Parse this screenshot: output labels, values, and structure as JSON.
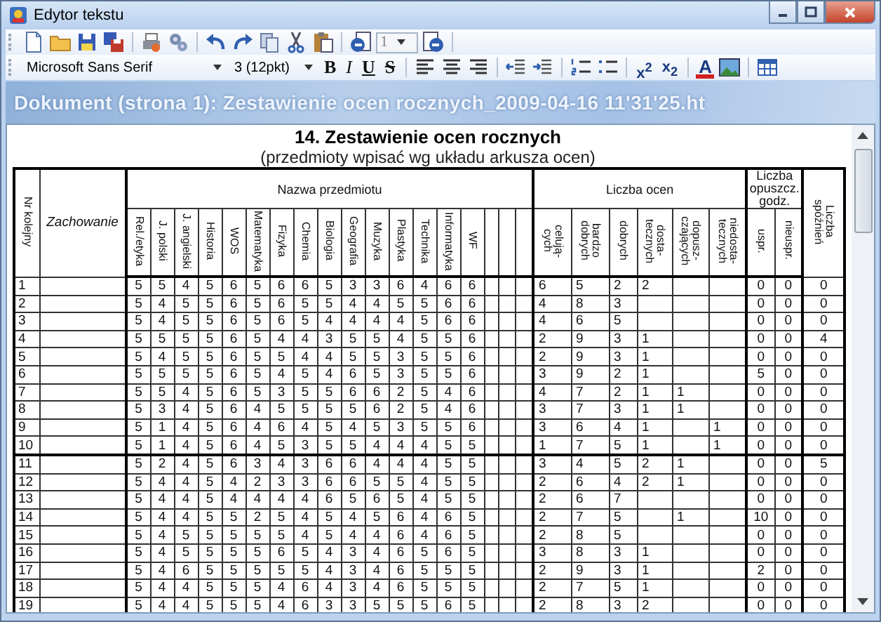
{
  "window": {
    "title": "Edytor tekstu"
  },
  "toolbar": {
    "page_spinner": {
      "value": "1"
    }
  },
  "format_bar": {
    "font": "Microsoft Sans Serif",
    "size": "3 (12pkt)",
    "style_buttons": [
      {
        "kind": "bold",
        "label": "B"
      },
      {
        "kind": "italic",
        "label": "I"
      },
      {
        "kind": "underline",
        "label": "U"
      },
      {
        "kind": "strike",
        "label": "S"
      }
    ],
    "script_buttons": [
      {
        "label": "x$^{2}$"
      },
      {
        "label": "x$_{2}$"
      }
    ],
    "font_color_button": {
      "label": "A"
    }
  },
  "banner": {
    "title": "Dokument (strona 1):  Zestawienie ocen rocznych_2009-04-16 11'31'25.ht"
  },
  "document": {
    "title": "14. Zestawienie ocen rocznych",
    "subtitle": "(przedmioty wpisać wg układu arkusza ocen)",
    "table": {
      "number_header": "Nr kolejny",
      "behaviour_header": "Zachowanie",
      "subjects_header": "Nazwa przedmiotu",
      "subjects": [
        "Rel./etyka",
        "J. polski",
        "J. angielski",
        "Historia",
        "WOS",
        "Matematyka",
        "Fizyka",
        "Chemia",
        "Biologia",
        "Geografia",
        "Muzyka",
        "Plastyka",
        "Technika",
        "Informatyka",
        "WF"
      ],
      "grades_header": "Liczba ocen",
      "grade_columns": [
        "celują-\ncych",
        "bardzo\ndobrych",
        "dobrych",
        "dosta-\ntecznych",
        "dopusz-\nczających",
        "niedosta-\ntecznych"
      ],
      "absences_header": "Liczba\nopuszcz.\ngodz.",
      "absence_columns": [
        "uspr.",
        "nieuspr."
      ],
      "late_header": "Liczba\nspóźnień",
      "rows": [
        {
          "nr": "1",
          "subject_grades": [
            "5",
            "5",
            "4",
            "5",
            "6",
            "5",
            "6",
            "6",
            "5",
            "3",
            "3",
            "6",
            "4",
            "6",
            "6"
          ],
          "grade_counts": {
            "excellent": "6",
            "very_good": "5",
            "good": "2",
            "satisfactory": "2"
          },
          "excused": "0",
          "unexcused": "0",
          "late": "0"
        },
        {
          "nr": "2",
          "subject_grades": [
            "5",
            "4",
            "5",
            "5",
            "6",
            "5",
            "6",
            "5",
            "5",
            "4",
            "4",
            "5",
            "5",
            "6",
            "6"
          ],
          "grade_counts": {
            "excellent": "4",
            "very_good": "8",
            "good": "3"
          },
          "excused": "0",
          "unexcused": "0",
          "late": "0"
        },
        {
          "nr": "3",
          "subject_grades": [
            "5",
            "4",
            "5",
            "5",
            "6",
            "5",
            "6",
            "5",
            "4",
            "4",
            "4",
            "4",
            "5",
            "6",
            "6"
          ],
          "grade_counts": {
            "excellent": "4",
            "very_good": "6",
            "good": "5"
          },
          "excused": "0",
          "unexcused": "0",
          "late": "0"
        },
        {
          "nr": "4",
          "subject_grades": [
            "5",
            "5",
            "5",
            "5",
            "6",
            "5",
            "4",
            "4",
            "3",
            "5",
            "5",
            "4",
            "5",
            "5",
            "6"
          ],
          "grade_counts": {
            "excellent": "2",
            "very_good": "9",
            "good": "3",
            "satisfactory": "1"
          },
          "excused": "0",
          "unexcused": "0",
          "late": "4"
        },
        {
          "nr": "5",
          "subject_grades": [
            "5",
            "4",
            "5",
            "5",
            "6",
            "5",
            "5",
            "4",
            "4",
            "5",
            "5",
            "3",
            "5",
            "5",
            "6"
          ],
          "grade_counts": {
            "excellent": "2",
            "very_good": "9",
            "good": "3",
            "satisfactory": "1"
          },
          "excused": "0",
          "unexcused": "0",
          "late": "0"
        },
        {
          "nr": "6",
          "subject_grades": [
            "5",
            "5",
            "5",
            "5",
            "6",
            "5",
            "4",
            "5",
            "4",
            "6",
            "5",
            "3",
            "5",
            "5",
            "6"
          ],
          "grade_counts": {
            "excellent": "3",
            "very_good": "9",
            "good": "2",
            "satisfactory": "1"
          },
          "excused": "5",
          "unexcused": "0",
          "late": "0"
        },
        {
          "nr": "7",
          "subject_grades": [
            "5",
            "5",
            "4",
            "5",
            "6",
            "5",
            "3",
            "5",
            "5",
            "6",
            "6",
            "2",
            "5",
            "4",
            "6"
          ],
          "grade_counts": {
            "excellent": "4",
            "very_good": "7",
            "good": "2",
            "satisfactory": "1",
            "sufficient": "1"
          },
          "excused": "0",
          "unexcused": "0",
          "late": "0"
        },
        {
          "nr": "8",
          "subject_grades": [
            "5",
            "3",
            "4",
            "5",
            "6",
            "4",
            "5",
            "5",
            "5",
            "5",
            "6",
            "2",
            "5",
            "4",
            "6"
          ],
          "grade_counts": {
            "excellent": "3",
            "very_good": "7",
            "good": "3",
            "satisfactory": "1",
            "sufficient": "1"
          },
          "excused": "0",
          "unexcused": "0",
          "late": "0"
        },
        {
          "nr": "9",
          "subject_grades": [
            "5",
            "1",
            "4",
            "5",
            "6",
            "4",
            "6",
            "4",
            "5",
            "4",
            "5",
            "3",
            "5",
            "5",
            "6"
          ],
          "grade_counts": {
            "excellent": "3",
            "very_good": "6",
            "good": "4",
            "satisfactory": "1",
            "insufficient": "1"
          },
          "excused": "0",
          "unexcused": "0",
          "late": "0"
        },
        {
          "nr": "10",
          "subject_grades": [
            "5",
            "1",
            "4",
            "5",
            "6",
            "4",
            "5",
            "3",
            "5",
            "5",
            "4",
            "4",
            "4",
            "5",
            "5"
          ],
          "grade_counts": {
            "excellent": "1",
            "very_good": "7",
            "good": "5",
            "satisfactory": "1",
            "insufficient": "1"
          },
          "excused": "0",
          "unexcused": "0",
          "late": "0"
        },
        {
          "nr": "11",
          "subject_grades": [
            "5",
            "2",
            "4",
            "5",
            "6",
            "3",
            "4",
            "3",
            "6",
            "6",
            "4",
            "4",
            "4",
            "5",
            "5"
          ],
          "grade_counts": {
            "excellent": "3",
            "very_good": "4",
            "good": "5",
            "satisfactory": "2",
            "sufficient": "1"
          },
          "excused": "0",
          "unexcused": "0",
          "late": "5"
        },
        {
          "nr": "12",
          "subject_grades": [
            "5",
            "4",
            "4",
            "5",
            "4",
            "2",
            "3",
            "3",
            "6",
            "6",
            "5",
            "5",
            "4",
            "5",
            "5"
          ],
          "grade_counts": {
            "excellent": "2",
            "very_good": "6",
            "good": "4",
            "satisfactory": "2",
            "sufficient": "1"
          },
          "excused": "0",
          "unexcused": "0",
          "late": "0"
        },
        {
          "nr": "13",
          "subject_grades": [
            "5",
            "4",
            "4",
            "5",
            "4",
            "4",
            "4",
            "4",
            "6",
            "5",
            "6",
            "5",
            "4",
            "5",
            "5"
          ],
          "grade_counts": {
            "excellent": "2",
            "very_good": "6",
            "good": "7"
          },
          "excused": "0",
          "unexcused": "0",
          "late": "0"
        },
        {
          "nr": "14",
          "subject_grades": [
            "5",
            "4",
            "4",
            "5",
            "5",
            "2",
            "5",
            "4",
            "5",
            "4",
            "5",
            "6",
            "4",
            "6",
            "5"
          ],
          "grade_counts": {
            "excellent": "2",
            "very_good": "7",
            "good": "5",
            "sufficient": "1"
          },
          "excused": "10",
          "unexcused": "0",
          "late": "0"
        },
        {
          "nr": "15",
          "subject_grades": [
            "5",
            "4",
            "5",
            "5",
            "5",
            "5",
            "5",
            "4",
            "5",
            "4",
            "4",
            "6",
            "4",
            "6",
            "5"
          ],
          "grade_counts": {
            "excellent": "2",
            "very_good": "8",
            "good": "5"
          },
          "excused": "0",
          "unexcused": "0",
          "late": "0"
        },
        {
          "nr": "16",
          "subject_grades": [
            "5",
            "4",
            "5",
            "5",
            "5",
            "5",
            "6",
            "5",
            "4",
            "3",
            "4",
            "6",
            "5",
            "6",
            "5"
          ],
          "grade_counts": {
            "excellent": "3",
            "very_good": "8",
            "good": "3",
            "satisfactory": "1"
          },
          "excused": "0",
          "unexcused": "0",
          "late": "0"
        },
        {
          "nr": "17",
          "subject_grades": [
            "5",
            "4",
            "6",
            "5",
            "5",
            "5",
            "5",
            "5",
            "4",
            "3",
            "4",
            "6",
            "5",
            "5",
            "5"
          ],
          "grade_counts": {
            "excellent": "2",
            "very_good": "9",
            "good": "3",
            "satisfactory": "1"
          },
          "excused": "2",
          "unexcused": "0",
          "late": "0"
        },
        {
          "nr": "18",
          "subject_grades": [
            "5",
            "4",
            "4",
            "5",
            "5",
            "5",
            "4",
            "6",
            "4",
            "3",
            "4",
            "6",
            "5",
            "5",
            "5"
          ],
          "grade_counts": {
            "excellent": "2",
            "very_good": "7",
            "good": "5",
            "satisfactory": "1"
          },
          "excused": "0",
          "unexcused": "0",
          "late": "0"
        },
        {
          "nr": "19",
          "subject_grades": [
            "5",
            "4",
            "4",
            "5",
            "5",
            "5",
            "4",
            "6",
            "3",
            "3",
            "5",
            "5",
            "5",
            "6",
            "5"
          ],
          "grade_counts": {
            "excellent": "2",
            "very_good": "8",
            "good": "3",
            "satisfactory": "2"
          },
          "excused": "0",
          "unexcused": "0",
          "late": "0"
        }
      ]
    }
  }
}
